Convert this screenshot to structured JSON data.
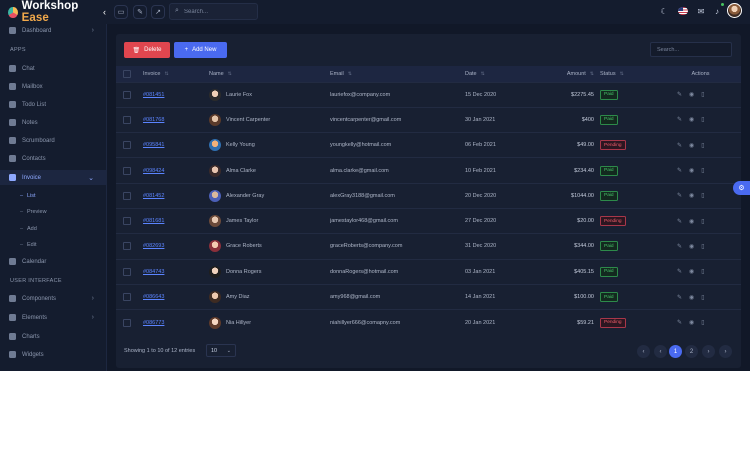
{
  "brand": {
    "name_main": "Workshop",
    "name_accent": "Ease",
    "chevron": "‹"
  },
  "topbar": {
    "search_placeholder": "Search...",
    "icons": [
      "layout-icon",
      "edit-icon",
      "external-icon",
      "moon-icon",
      "flag-icon",
      "mail-icon",
      "bell-icon"
    ]
  },
  "sidebar": {
    "dashboard": "Dashboard",
    "section_apps": "APPS",
    "apps": [
      "Chat",
      "Mailbox",
      "Todo List",
      "Notes",
      "Scrumboard",
      "Contacts",
      "Invoice"
    ],
    "invoice_sub": [
      "List",
      "Preview",
      "Add",
      "Edit"
    ],
    "calendar": "Calendar",
    "section_ui": "USER INTERFACE",
    "ui": [
      "Components",
      "Elements",
      "Charts",
      "Widgets"
    ]
  },
  "toolbar": {
    "delete_label": "Delete",
    "add_label": "Add New",
    "search_placeholder": "Search..."
  },
  "table": {
    "headers": {
      "invoice": "Invoice",
      "name": "Name",
      "email": "Email",
      "date": "Date",
      "amount": "Amount",
      "status": "Status",
      "actions": "Actions"
    },
    "rows": [
      {
        "invoice": "#081451",
        "name": "Laurie Fox",
        "email": "lauriefox@company.com",
        "date": "15 Dec 2020",
        "amount": "$2275.45",
        "status": "Paid"
      },
      {
        "invoice": "#081768",
        "name": "Vincent Carpenter",
        "email": "vincentcarpenter@gmail.com",
        "date": "30 Jan 2021",
        "amount": "$400",
        "status": "Paid"
      },
      {
        "invoice": "#095841",
        "name": "Kelly Young",
        "email": "youngkelly@hotmail.com",
        "date": "06 Feb 2021",
        "amount": "$49.00",
        "status": "Pending"
      },
      {
        "invoice": "#098424",
        "name": "Alma Clarke",
        "email": "alma.clarke@gmail.com",
        "date": "10 Feb 2021",
        "amount": "$234.40",
        "status": "Paid"
      },
      {
        "invoice": "#081452",
        "name": "Alexander Gray",
        "email": "alexGray3188@gmail.com",
        "date": "20 Dec 2020",
        "amount": "$1044.00",
        "status": "Paid"
      },
      {
        "invoice": "#081681",
        "name": "James Taylor",
        "email": "jamestaylor468@gmail.com",
        "date": "27 Dec 2020",
        "amount": "$20.00",
        "status": "Pending"
      },
      {
        "invoice": "#082693",
        "name": "Grace Roberts",
        "email": "graceRoberts@company.com",
        "date": "31 Dec 2020",
        "amount": "$344.00",
        "status": "Paid"
      },
      {
        "invoice": "#084743",
        "name": "Donna Rogers",
        "email": "donnaRogers@hotmail.com",
        "date": "03 Jan 2021",
        "amount": "$405.15",
        "status": "Paid"
      },
      {
        "invoice": "#086643",
        "name": "Amy Diaz",
        "email": "amy968@gmail.com",
        "date": "14 Jan 2021",
        "amount": "$100.00",
        "status": "Paid"
      },
      {
        "invoice": "#086773",
        "name": "Nia Hillyer",
        "email": "niahillyer666@comapny.com",
        "date": "20 Jan 2021",
        "amount": "$59.21",
        "status": "Pending"
      }
    ]
  },
  "footer": {
    "showing": "Showing 1 to 10 of 12 entries",
    "per_page": "10",
    "pages": [
      "1",
      "2"
    ]
  },
  "colors": {
    "paid": "#47c36a",
    "pending": "#ef5c69",
    "accent": "#4a6af0",
    "delete": "#e0464f"
  }
}
